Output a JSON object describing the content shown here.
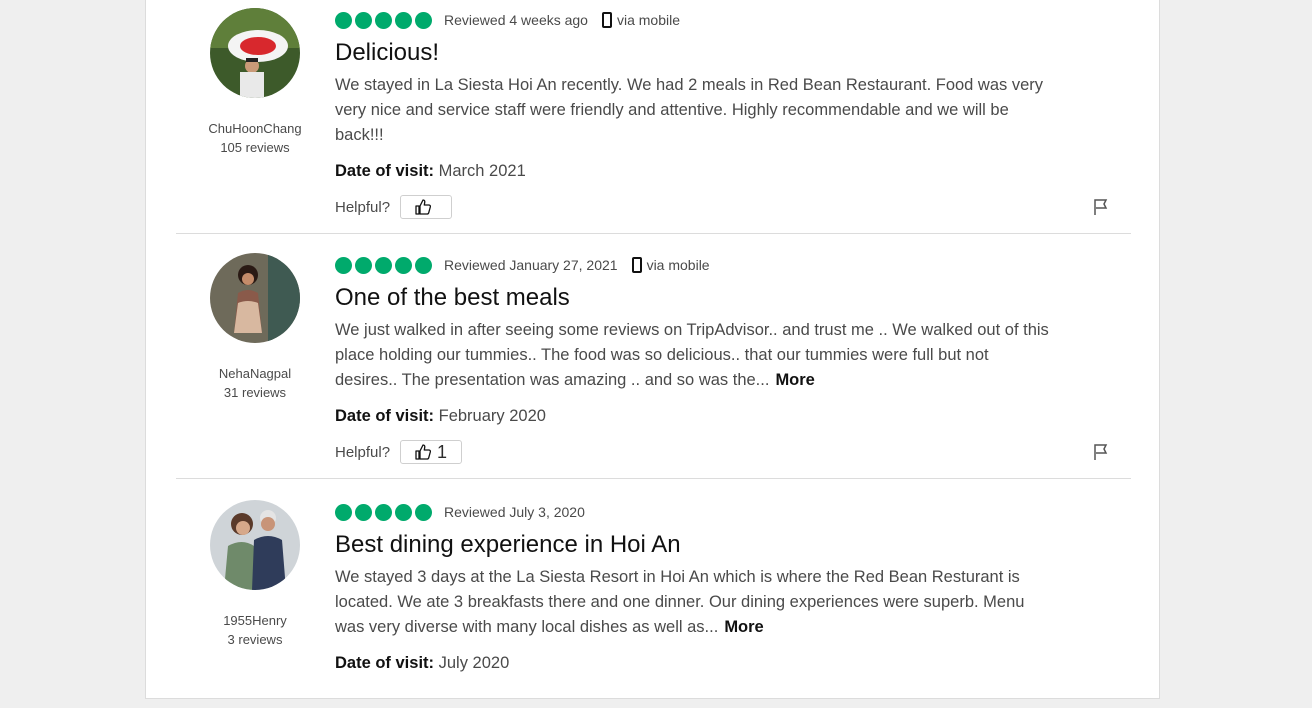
{
  "reviews": [
    {
      "user": "ChuHoonChang",
      "review_count": "105 reviews",
      "reviewed": "Reviewed 4 weeks ago",
      "mobile": "via mobile",
      "rating": 5,
      "title": "Delicious!",
      "body": "We stayed in La Siesta Hoi An recently. We had 2 meals in Red Bean Restaurant. Food was very very nice and service staff were friendly and attentive. Highly recommendable and we will be back!!!",
      "more": "",
      "date_label": "Date of visit:",
      "date": "March 2021",
      "helpful_label": "Helpful?",
      "helpful_count": ""
    },
    {
      "user": "NehaNagpal",
      "review_count": "31 reviews",
      "reviewed": "Reviewed January 27, 2021",
      "mobile": "via mobile",
      "rating": 5,
      "title": "One of the best meals",
      "body": "We just walked in after seeing some reviews on TripAdvisor.. and trust me .. We walked out of this place holding our tummies.. The food was so delicious.. that our tummies were full but not desires.. The presentation was amazing .. and so was the...",
      "more": "More",
      "date_label": "Date of visit:",
      "date": "February 2020",
      "helpful_label": "Helpful?",
      "helpful_count": "1"
    },
    {
      "user": "1955Henry",
      "review_count": "3 reviews",
      "reviewed": "Reviewed July 3, 2020",
      "mobile": "",
      "rating": 5,
      "title": "Best dining experience in Hoi An",
      "body": "We stayed 3 days at the La Siesta Resort in Hoi An which is where the Red Bean Resturant is located. We ate 3 breakfasts there and one dinner. Our dining experiences were superb. Menu was very diverse with many local dishes as well as...",
      "more": "More",
      "date_label": "Date of visit:",
      "date": "July 2020"
    }
  ],
  "colors": {
    "rating_green": "#00aa6c",
    "divider": "#dcdcdc"
  },
  "icons": {
    "rating": "rating-bubble-icon",
    "mobile": "mobile-phone-icon",
    "helpful": "thumbs-up-icon",
    "report": "flag-icon"
  }
}
